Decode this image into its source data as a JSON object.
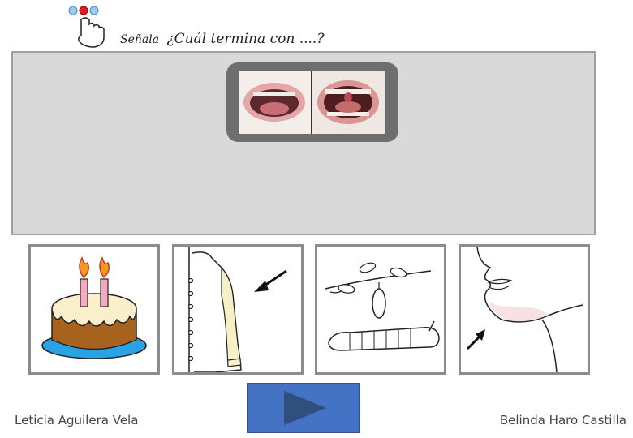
{
  "header": {
    "instruction_prefix": "Señala",
    "instruction_question": "¿Cuál termina con ....?"
  },
  "cards": [
    {
      "icon": "birthday-cake-icon"
    },
    {
      "icon": "shirt-sleeve-icon"
    },
    {
      "icon": "silkworm-icon"
    },
    {
      "icon": "chin-neck-icon"
    }
  ],
  "controls": {
    "play_icon": "play-icon"
  },
  "footer": {
    "left_author": "Leticia Aguilera Vela",
    "right_author": "Belinda Haro Castilla"
  },
  "colors": {
    "stage": "#d9d9d9",
    "play_button": "#4472c4",
    "play_arrow": "#2f4f7f",
    "card_border": "#8c8c8c"
  }
}
